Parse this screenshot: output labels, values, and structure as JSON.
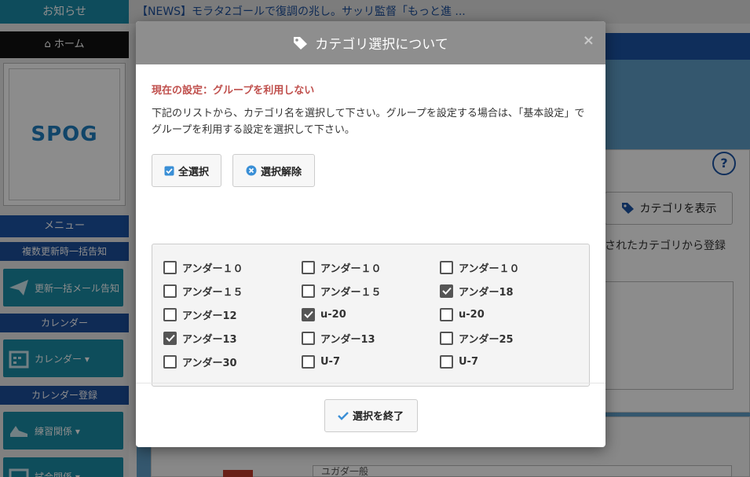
{
  "sidebar": {
    "notice": "お知らせ",
    "home": "ホーム",
    "logo_text": "SPOG",
    "menu_header": "メニュー",
    "bulk_notice": "複数更新時一括告知",
    "mail_button": "更新一括メール告知",
    "calendar_header": "カレンダー",
    "calendar_button": "カレンダー ▾",
    "calendar_register": "カレンダー登録",
    "practice_button": "練習関係 ▾",
    "match_button": "試合関係 ▾"
  },
  "topbar": {
    "news": "【NEWS】モラタ2ゴールで復調の兆し。サッリ監督「もっと進 ..."
  },
  "background": {
    "show_category": "カテゴリを表示",
    "hint": "されたカテゴリから登録",
    "input_partial": "ユガダ一般"
  },
  "modal": {
    "title": "カテゴリ選択について",
    "close": "×",
    "setting": "現在の設定：グループを利用しない",
    "description": "下記のリストから、カテゴリ名を選択して下さい。グループを設定する場合は、「基本設定」でグループを利用する設定を選択して下さい。",
    "select_all": "全選択",
    "clear": "選択解除",
    "finish": "選択を終了",
    "categories": [
      {
        "label": "アンダー１０",
        "checked": false
      },
      {
        "label": "アンダー１０",
        "checked": false
      },
      {
        "label": "アンダー１０",
        "checked": false
      },
      {
        "label": "アンダー１５",
        "checked": false
      },
      {
        "label": "アンダー１５",
        "checked": false
      },
      {
        "label": "アンダー18",
        "checked": true
      },
      {
        "label": "アンダー12",
        "checked": false
      },
      {
        "label": "u-20",
        "checked": true
      },
      {
        "label": "u-20",
        "checked": false
      },
      {
        "label": "アンダー13",
        "checked": true
      },
      {
        "label": "アンダー13",
        "checked": false
      },
      {
        "label": "アンダー25",
        "checked": false
      },
      {
        "label": "アンダー30",
        "checked": false
      },
      {
        "label": "U-7",
        "checked": false
      },
      {
        "label": "U-7",
        "checked": false
      }
    ]
  },
  "colors": {
    "accent_blue": "#1d55a6",
    "teal": "#1a8ca6",
    "warning_red": "#c0504d",
    "header_gray": "#8e8e8e",
    "check_blue": "#3a8fd6"
  }
}
